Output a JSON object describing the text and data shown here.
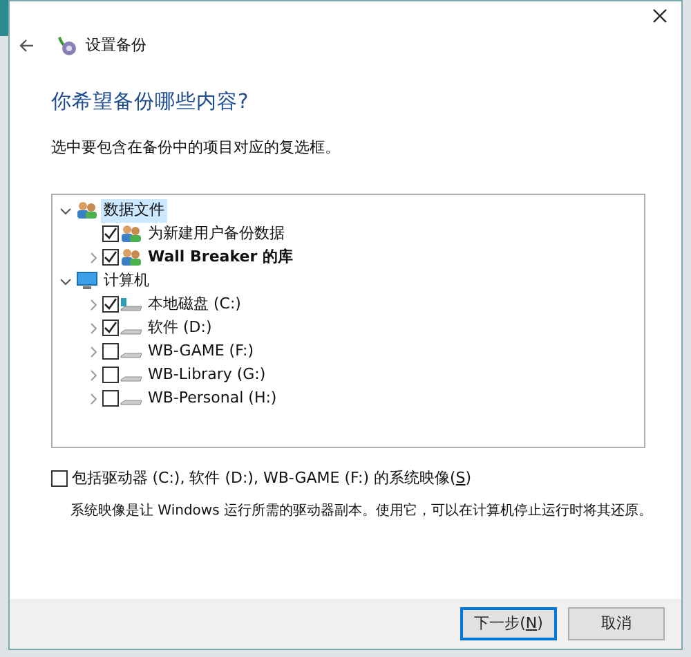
{
  "window": {
    "title": "设置备份"
  },
  "heading": "你希望备份哪些内容?",
  "instruction": "选中要包含在备份中的项目对应的复选框。",
  "tree": [
    {
      "label": "数据文件",
      "kind": "users",
      "expanded": true,
      "selected": true,
      "bold": false,
      "children": [
        {
          "label": "为新建用户备份数据",
          "kind": "users",
          "checked": true,
          "selected": false,
          "bold": false
        },
        {
          "label": "Wall Breaker 的库",
          "kind": "users",
          "checked": true,
          "expanded": false,
          "selected": false,
          "bold": true
        }
      ]
    },
    {
      "label": "计算机",
      "kind": "monitor",
      "expanded": true,
      "selected": false,
      "bold": false,
      "children": [
        {
          "label": "本地磁盘 (C:)",
          "kind": "system-drive",
          "checked": true,
          "expanded": false,
          "selected": false,
          "bold": false
        },
        {
          "label": "软件 (D:)",
          "kind": "drive",
          "checked": true,
          "expanded": false,
          "selected": false,
          "bold": false
        },
        {
          "label": "WB-GAME (F:)",
          "kind": "drive",
          "checked": false,
          "expanded": false,
          "selected": false,
          "bold": false
        },
        {
          "label": "WB-Library (G:)",
          "kind": "drive",
          "checked": false,
          "expanded": false,
          "selected": false,
          "bold": false
        },
        {
          "label": "WB-Personal (H:)",
          "kind": "drive",
          "checked": false,
          "expanded": false,
          "selected": false,
          "bold": false
        }
      ]
    }
  ],
  "system_image": {
    "label": "包括驱动器 (C:), 软件 (D:), WB-GAME (F:) 的系统映像(",
    "access_key": "S",
    "label_end": ")",
    "checked": false
  },
  "system_image_note": "系统映像是让 Windows 运行所需的驱动器副本。使用它，可以在计算机停止运行时将其还原。",
  "buttons": [
    {
      "label": "下一步(",
      "access_key": "N",
      "label_end": ")",
      "default": true
    },
    {
      "label": "取消",
      "default": false
    }
  ]
}
